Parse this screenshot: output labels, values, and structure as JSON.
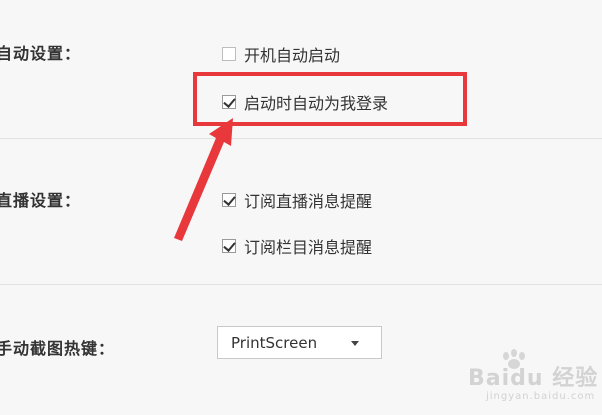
{
  "sections": {
    "startup": {
      "label": "自动设置：",
      "options": [
        {
          "label": "开机自动启动",
          "checked": false
        },
        {
          "label": "启动时自动为我登录",
          "checked": true
        }
      ]
    },
    "live": {
      "label": "直播设置：",
      "options": [
        {
          "label": "订阅直播消息提醒",
          "checked": true
        },
        {
          "label": "订阅栏目消息提醒",
          "checked": true
        }
      ]
    },
    "hotkey": {
      "label": "手动截图热键：",
      "dropdown_value": "PrintScreen"
    }
  },
  "annotation": {
    "highlight_color": "#e8383c"
  },
  "watermark": {
    "text": "Baidu 经验",
    "sub": "jingyan.baidu.com"
  }
}
